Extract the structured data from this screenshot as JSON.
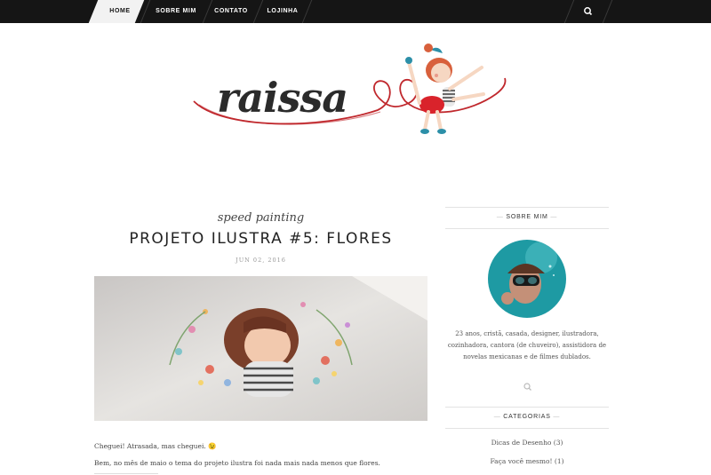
{
  "nav": {
    "items": [
      {
        "label": "HOME"
      },
      {
        "label": "SOBRE MIM"
      },
      {
        "label": "CONTATO"
      },
      {
        "label": "LOJINHA"
      }
    ],
    "search_icon": "search-icon"
  },
  "header": {
    "logo_text": "raissa"
  },
  "post": {
    "category": "speed painting",
    "title": "PROJETO ILUSTRA #5: FLORES",
    "date": "JUN 02, 2016",
    "paragraphs": [
      "Cheguei! Atrasada, mas cheguei. 😉",
      "Bem, no mês de maio o tema do projeto ilustra foi nada mais nada menos que flores."
    ]
  },
  "sidebar": {
    "about_heading": "SOBRE MIM",
    "about_text": "23 anos, cristã, casada, designer, ilustradora, cozinhadora, cantora (de chuveiro), assistidora de novelas mexicanas e de filmes dublados.",
    "categories_heading": "CATEGORIAS",
    "categories": [
      {
        "label": "Dicas de Desenho (3)"
      },
      {
        "label": "Faça você mesmo! (1)"
      }
    ]
  },
  "colors": {
    "nav_bg": "#151515",
    "accent_red": "#c0282d"
  }
}
